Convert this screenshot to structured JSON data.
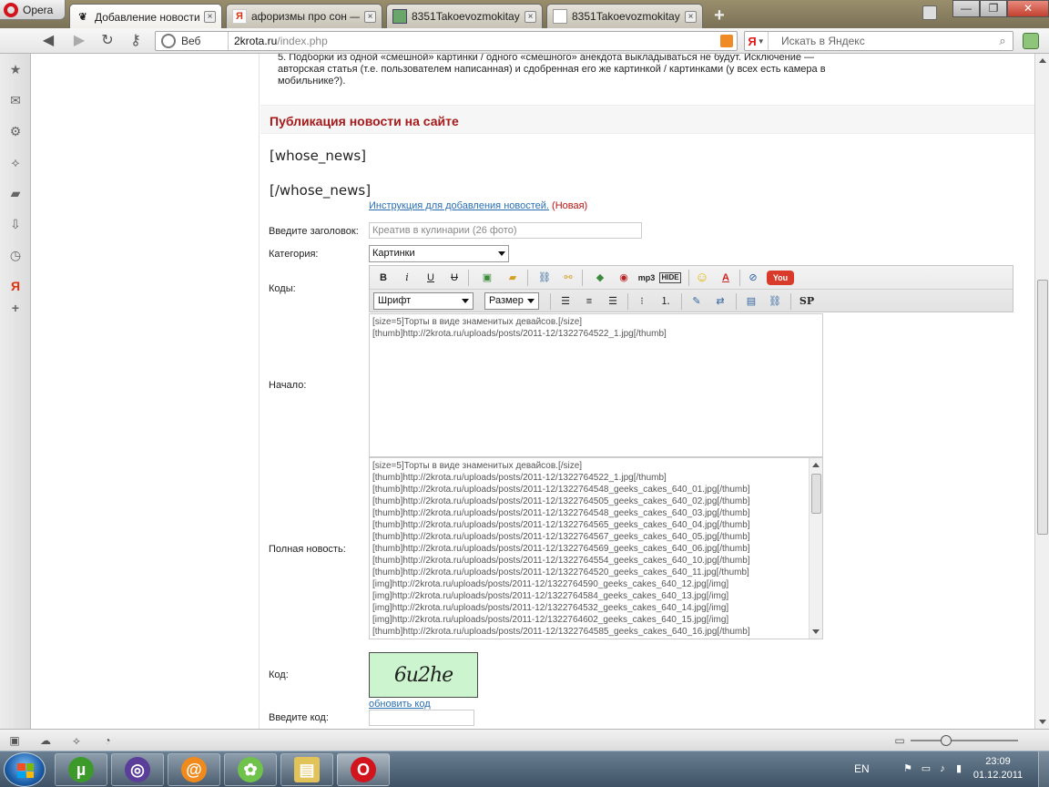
{
  "browser": {
    "menu_label": "Opera",
    "tabs": [
      {
        "label": "Добавление новости ...",
        "icon": "crow-icon",
        "active": true
      },
      {
        "label": "афоризмы про сон —...",
        "icon": "yandex-icon",
        "active": false
      },
      {
        "label": "8351Takoevozmokitay-...",
        "icon": "image-icon",
        "active": false
      },
      {
        "label": "8351Takoevozmokitay-...",
        "icon": "page-icon",
        "active": false
      }
    ],
    "new_tab": "+",
    "address": {
      "prefix": "Веб",
      "host": "2krota.ru",
      "path": "/index.php"
    },
    "search_engine": "Я",
    "search_placeholder": "Искать в Яндекс"
  },
  "page": {
    "notice_text": "5. Подборки из одной «смешной» картинки / одного «смешного» анекдота выкладываться не будут. Исключение — авторская статья (т.е. пользователем написанная) и сдобренная его же картинкой / картинками (у всех есть камера в мобильнике?).",
    "section_title": "Публикация новости на сайте",
    "tag_open": "[whose_news]",
    "tag_close": "[/whose_news]",
    "instruction_link": "Инструкция для добавления новостей.",
    "instruction_badge": "(Новая)",
    "form": {
      "title_label": "Введите заголовок:",
      "title_value": "Креатив в кулинарии (26 фото)",
      "category_label": "Категория:",
      "category_value": "Картинки",
      "codes_label": "Коды:",
      "start_label": "Начало:",
      "full_label": "Полная новость:",
      "captcha_label": "Код:",
      "captcha_text": "6u2he",
      "refresh_link": "обновить код",
      "code_input_label": "Введите код:"
    },
    "editor": {
      "bold": "B",
      "italic": "i",
      "underline": "U",
      "strike": "U",
      "mp3": "mp3",
      "hide": "HIDE",
      "sp": "SP",
      "font_select": "Шрифт",
      "size_select": "Размер"
    },
    "start_text": [
      "[size=5]Торты в виде знаменитых девайсов.[/size]",
      "[thumb]http://2krota.ru/uploads/posts/2011-12/1322764522_1.jpg[/thumb]"
    ],
    "full_text": [
      "[size=5]Торты в виде знаменитых девайсов.[/size]",
      "[thumb]http://2krota.ru/uploads/posts/2011-12/1322764522_1.jpg[/thumb]",
      "[thumb]http://2krota.ru/uploads/posts/2011-12/1322764548_geeks_cakes_640_01.jpg[/thumb]",
      "[thumb]http://2krota.ru/uploads/posts/2011-12/1322764505_geeks_cakes_640_02.jpg[/thumb]",
      "[thumb]http://2krota.ru/uploads/posts/2011-12/1322764548_geeks_cakes_640_03.jpg[/thumb]",
      "[thumb]http://2krota.ru/uploads/posts/2011-12/1322764565_geeks_cakes_640_04.jpg[/thumb]",
      "[thumb]http://2krota.ru/uploads/posts/2011-12/1322764567_geeks_cakes_640_05.jpg[/thumb]",
      "[thumb]http://2krota.ru/uploads/posts/2011-12/1322764569_geeks_cakes_640_06.jpg[/thumb]",
      "[thumb]http://2krota.ru/uploads/posts/2011-12/1322764554_geeks_cakes_640_10.jpg[/thumb]",
      "[thumb]http://2krota.ru/uploads/posts/2011-12/1322764520_geeks_cakes_640_11.jpg[/thumb]",
      "[img]http://2krota.ru/uploads/posts/2011-12/1322764590_geeks_cakes_640_12.jpg[/img]",
      "[img]http://2krota.ru/uploads/posts/2011-12/1322764584_geeks_cakes_640_13.jpg[/img]",
      "[img]http://2krota.ru/uploads/posts/2011-12/1322764532_geeks_cakes_640_14.jpg[/img]",
      "[img]http://2krota.ru/uploads/posts/2011-12/1322764602_geeks_cakes_640_15.jpg[/img]",
      "[thumb]http://2krota.ru/uploads/posts/2011-12/1322764585_geeks_cakes_640_16.jpg[/thumb]"
    ]
  },
  "taskbar": {
    "lang": "EN",
    "time": "23:09",
    "date": "01.12.2011",
    "apps": [
      "utorrent-icon",
      "bittorrent-icon",
      "mail-agent-icon",
      "icq-icon",
      "explorer-icon",
      "opera-icon"
    ]
  },
  "colors": {
    "section_title": "#a51a1a",
    "link": "#2a6fb3",
    "captcha_bg": "#ccf5cf"
  }
}
